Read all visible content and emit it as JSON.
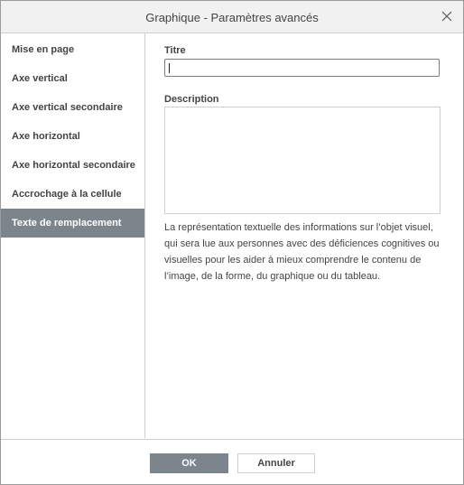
{
  "dialog": {
    "title": "Graphique - Paramètres avancés"
  },
  "sidebar": {
    "items": [
      {
        "label": "Mise en page"
      },
      {
        "label": "Axe vertical"
      },
      {
        "label": "Axe vertical secondaire"
      },
      {
        "label": "Axe horizontal"
      },
      {
        "label": "Axe horizontal secondaire"
      },
      {
        "label": "Accrochage à la cellule"
      },
      {
        "label": "Texte de remplacement"
      }
    ],
    "active_item": "Texte de remplacement"
  },
  "content": {
    "title_label": "Titre",
    "title_value": "",
    "description_label": "Description",
    "description_value": "",
    "help_text": "La représentation textuelle des informations sur l’objet visuel, qui sera lue aux personnes avec des déficiences cognitives ou visuelles pour les aider à mieux comprendre le contenu de l’image, de la forme, du graphique ou du tableau."
  },
  "footer": {
    "ok_label": "OK",
    "cancel_label": "Annuler"
  },
  "icons": {
    "close": "close-icon"
  },
  "colors": {
    "active_background": "#7d858c",
    "titlebar_background": "#f1f1f1"
  }
}
